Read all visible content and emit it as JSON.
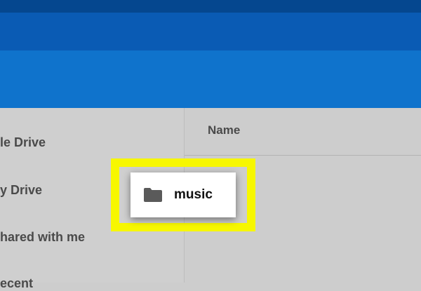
{
  "sidebar": {
    "items": [
      {
        "label": "le Drive"
      },
      {
        "label": "y Drive"
      },
      {
        "label": "hared with me"
      },
      {
        "label": "ecent"
      }
    ]
  },
  "file_list": {
    "column_header": "Name",
    "items": [
      {
        "name": "music",
        "icon": "folder-icon"
      }
    ]
  },
  "colors": {
    "header_dark": "#05478f",
    "header_mid": "#0a5bb4",
    "toolbar": "#0f73cc",
    "highlight": "#f7f700"
  }
}
